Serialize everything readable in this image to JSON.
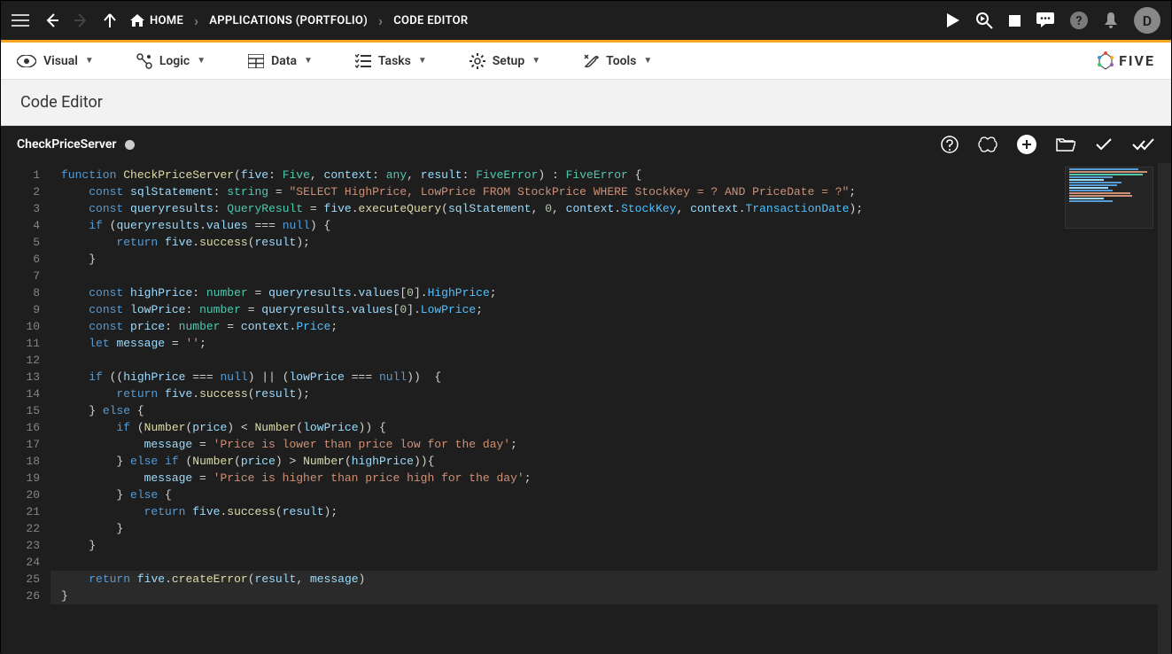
{
  "topbar": {
    "home_label": "HOME",
    "breadcrumb_app": "APPLICATIONS (PORTFOLIO)",
    "breadcrumb_editor": "CODE EDITOR",
    "avatar_letter": "D"
  },
  "menu": {
    "visual": "Visual",
    "logic": "Logic",
    "data": "Data",
    "tasks": "Tasks",
    "setup": "Setup",
    "tools": "Tools",
    "brand": "FIVE"
  },
  "page": {
    "title": "Code Editor"
  },
  "tab": {
    "name": "CheckPriceServer"
  },
  "code": {
    "function_kw": "function",
    "function_name": "CheckPriceServer",
    "param_five": "five",
    "type_five": "Five",
    "param_context": "context",
    "type_any": "any",
    "param_result": "result",
    "type_fiveerror": "FiveError",
    "const_kw": "const",
    "let_kw": "let",
    "if_kw": "if",
    "else_kw": "else",
    "return_kw": "return",
    "null_kw": "null",
    "sqlStatement": "sqlStatement",
    "type_string": "string",
    "sql_value": "\"SELECT HighPrice, LowPrice FROM StockPrice WHERE StockKey = ? AND PriceDate = ?\"",
    "queryresults": "queryresults",
    "type_queryresult": "QueryResult",
    "executeQuery": "executeQuery",
    "zero": "0",
    "stockkey": "StockKey",
    "txndate": "TransactionDate",
    "values": "values",
    "success": "success",
    "highPrice": "highPrice",
    "lowPrice": "lowPrice",
    "price": "price",
    "message_var": "message",
    "type_number": "number",
    "HighPrice": "HighPrice",
    "LowPrice": "LowPrice",
    "Price_prop": "Price",
    "empty": "''",
    "number_fn": "Number",
    "msg_low": "'Price is lower than price low for the day'",
    "msg_high": "'Price is higher than price high for the day'",
    "createError": "createError"
  },
  "line_numbers": [
    "1",
    "2",
    "3",
    "4",
    "5",
    "6",
    "7",
    "8",
    "9",
    "10",
    "11",
    "12",
    "13",
    "14",
    "15",
    "16",
    "17",
    "18",
    "19",
    "20",
    "21",
    "22",
    "23",
    "24",
    "25",
    "26"
  ]
}
